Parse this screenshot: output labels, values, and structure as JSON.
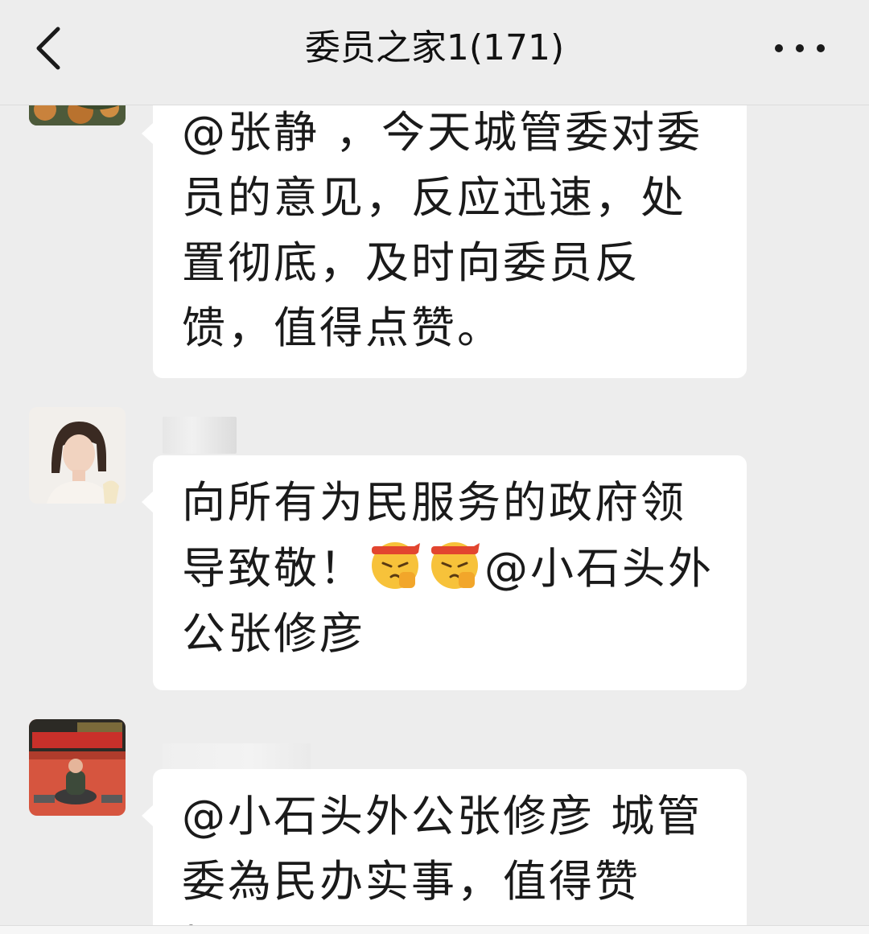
{
  "header": {
    "title": "委员之家1(171)"
  },
  "messages": [
    {
      "text": "@张静 ，今天城管委对委员的意见，反应迅速，处置彻底，及时向委员反馈，值得点赞。"
    },
    {
      "text_before_emoji": "向所有为民服务的政府领导致敬！",
      "emoji": [
        "fist-headband-emoji",
        "fist-headband-emoji"
      ],
      "text_after_emoji": "@小石头外公张修彦"
    },
    {
      "text": "@小石头外公张修彦  城管委為民办实事，值得赞扬！"
    }
  ],
  "icons": {
    "back": "chevron-left-icon",
    "more": "more-dots-icon"
  },
  "colors": {
    "background": "#ededed",
    "bubble": "#ffffff",
    "text": "#1a1a1a"
  }
}
